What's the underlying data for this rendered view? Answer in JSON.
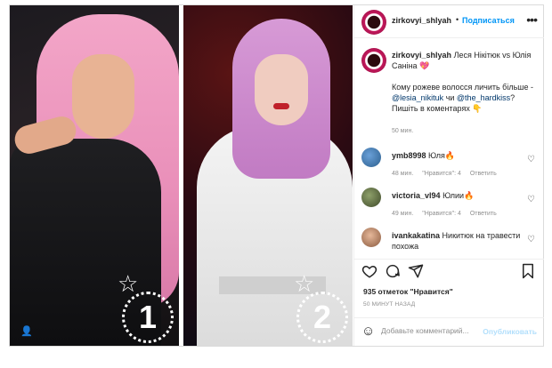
{
  "post": {
    "username": "zirkovyi_shlyah",
    "follow_label": "Подписаться",
    "more_label": "•••",
    "caption": {
      "author": "zirkovyi_shlyah",
      "line1": "Леся Нікітюк vs Юлія Саніна 💖",
      "line2_pre": "Кому рожеве волосся личить більше -",
      "mention1": "@lesia_nikituk",
      "mid": "чи",
      "mention2": "@the_hardkiss",
      "line2_post": "?",
      "line3": "Пишіть в коментарях 👇"
    },
    "time": "50 мин.",
    "images": [
      {
        "badge": "1"
      },
      {
        "badge": "2"
      }
    ]
  },
  "comments": [
    {
      "user": "ymb8998",
      "text": "Юля🔥",
      "time": "48 мин.",
      "likes": "\"Нравится\": 4",
      "reply": "Ответить"
    },
    {
      "user": "victoria_vl94",
      "text": "Юлии🔥",
      "time": "49 мин.",
      "likes": "\"Нравится\": 4",
      "reply": "Ответить"
    },
    {
      "user": "ivankakatina",
      "text": "Никитюк на травести похожа"
    }
  ],
  "likes_count": "935 отметок \"Нравится\"",
  "posted_ago": "50 МИНУТ НАЗАД",
  "comment_bar": {
    "placeholder": "Добавьте комментарий...",
    "post_label": "Опубликовать"
  },
  "icons": {
    "heart": "heart-icon",
    "comment": "comment-icon",
    "share": "share-icon",
    "save": "bookmark-icon",
    "emoji": "emoji-icon"
  },
  "colors": {
    "link_blue": "#0095f6",
    "mention_blue": "#00376b",
    "muted": "#8e8e8e",
    "post_disabled": "#b2dffc"
  }
}
